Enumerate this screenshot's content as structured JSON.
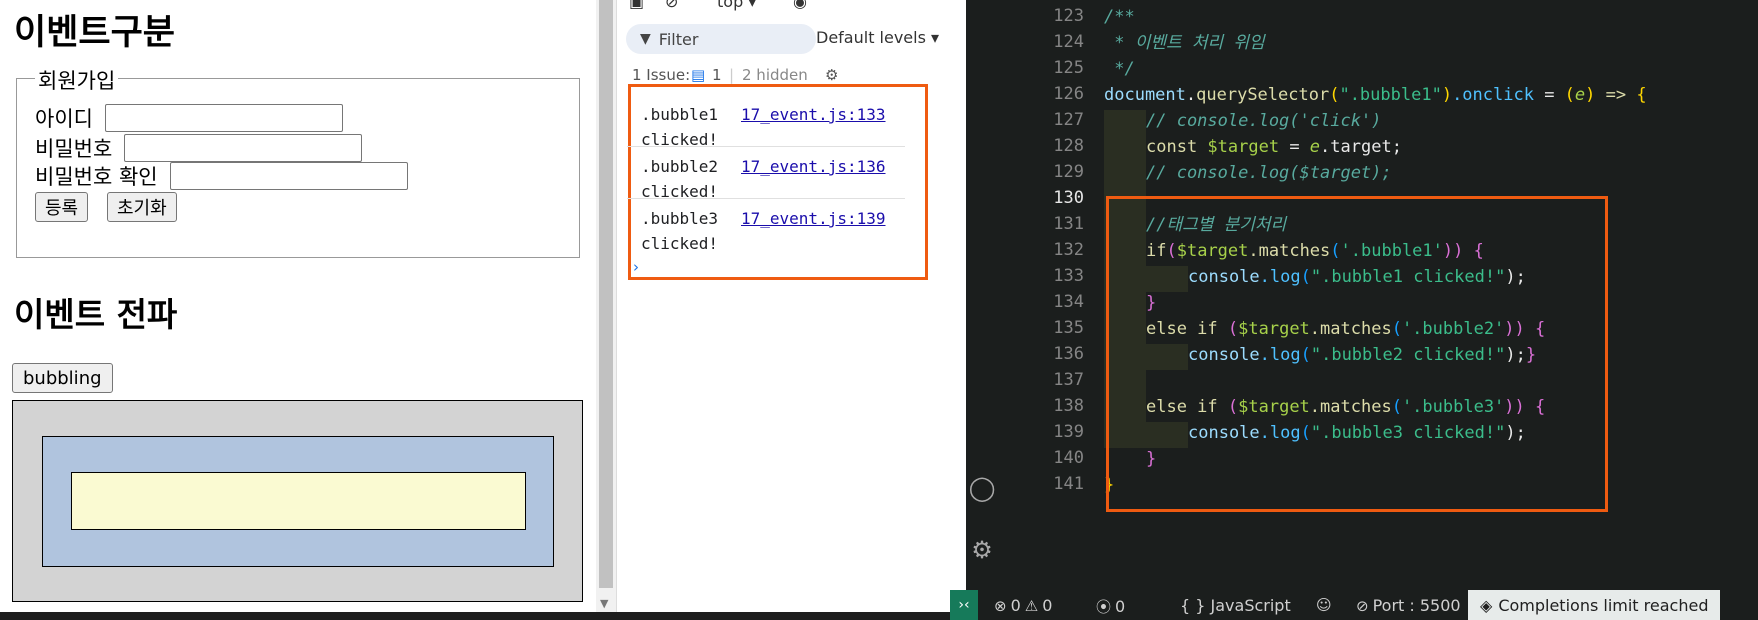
{
  "page": {
    "event_heading": "이벤트구분",
    "signup": {
      "legend": "회원가입",
      "id_label": "아이디",
      "pw_label": "비밀번호",
      "pw_confirm_label": "비밀번호 확인",
      "submit_label": "등록",
      "reset_label": "초기화"
    },
    "propagation_heading": "이벤트 전파",
    "bubbling_button": "bubbling"
  },
  "devtools": {
    "context": "top ▾",
    "filter_placeholder": "Filter",
    "levels": "Default levels ▾",
    "issues_label": "1 Issue:",
    "issues_count": "1",
    "hidden_label": "2 hidden",
    "messages": [
      {
        "text_line1": ".bubble1",
        "text_line2": "clicked!",
        "source": "17_event.js:133"
      },
      {
        "text_line1": ".bubble2",
        "text_line2": "clicked!",
        "source": "17_event.js:136"
      },
      {
        "text_line1": ".bubble3",
        "text_line2": "clicked!",
        "source": "17_event.js:139"
      }
    ],
    "prompt": "›"
  },
  "editor": {
    "line_numbers": [
      "123",
      "124",
      "125",
      "126",
      "127",
      "128",
      "129",
      "130",
      "131",
      "132",
      "133",
      "134",
      "135",
      "136",
      "137",
      "138",
      "139",
      "140",
      "141"
    ],
    "active_line": "130",
    "code": {
      "l123": "/**",
      "l124": " * 이벤트 처리 위임",
      "l125": " */",
      "l126_obj": "document",
      "l126_dot": ".",
      "l126_fn": "querySelector",
      "l126_p1": "(",
      "l126_str": "\".bubble1\"",
      "l126_p2": ")",
      "l126_prop": ".onclick",
      "l126_eq": " = ",
      "l126_p3": "(",
      "l126_e": "e",
      "l126_p4": ")",
      "l126_arrow": " => ",
      "l126_brace": "{",
      "l127": "// console.log('click')",
      "l128_kw": "const",
      "l128_var": " $target",
      "l128_eq": " = ",
      "l128_e": "e",
      "l128_rest": ".target;",
      "l129": "// console.log($target);",
      "l131": "//태그별 분기처리",
      "l132_if": "if",
      "l132_p1": "(",
      "l132_var": "$target",
      "l132_fn": ".matches",
      "l132_p2": "(",
      "l132_str": "'.bubble1'",
      "l132_p3": "))",
      "l132_brace": " {",
      "l133_obj": "console",
      "l133_fn": ".log",
      "l133_p1": "(",
      "l133_str": "\".bubble1 clicked!\"",
      "l133_p2": ");",
      "l134": "}",
      "l135_else": "else if ",
      "l135_p1": "(",
      "l135_var": "$target",
      "l135_fn": ".matches",
      "l135_p2": "(",
      "l135_str": "'.bubble2'",
      "l135_p3": "))",
      "l135_brace": " {",
      "l136_obj": "console",
      "l136_fn": ".log",
      "l136_p1": "(",
      "l136_str": "\".bubble2 clicked!\"",
      "l136_p2": ");",
      "l136_brace": "}",
      "l138_else": "else if ",
      "l138_p1": "(",
      "l138_var": "$target",
      "l138_fn": ".matches",
      "l138_p2": "(",
      "l138_str": "'.bubble3'",
      "l138_p3": "))",
      "l138_brace": " {",
      "l139_obj": "console",
      "l139_fn": ".log",
      "l139_p1": "(",
      "l139_str": "\".bubble3 clicked!\"",
      "l139_p2": ");",
      "l140": "}",
      "l141": "}"
    }
  },
  "statusbar": {
    "errors": "0",
    "warnings": "0",
    "ports": "0",
    "language": "{ } JavaScript",
    "port": "Port : 5500",
    "completions": "Completions limit reached"
  },
  "colors": {
    "highlight_box": "#ef5b11",
    "editor_bg": "#1b1e1d",
    "bubble1_bg": "#d3d3d3",
    "bubble2_bg": "#b0c4de",
    "bubble3_bg": "#fafad2"
  }
}
